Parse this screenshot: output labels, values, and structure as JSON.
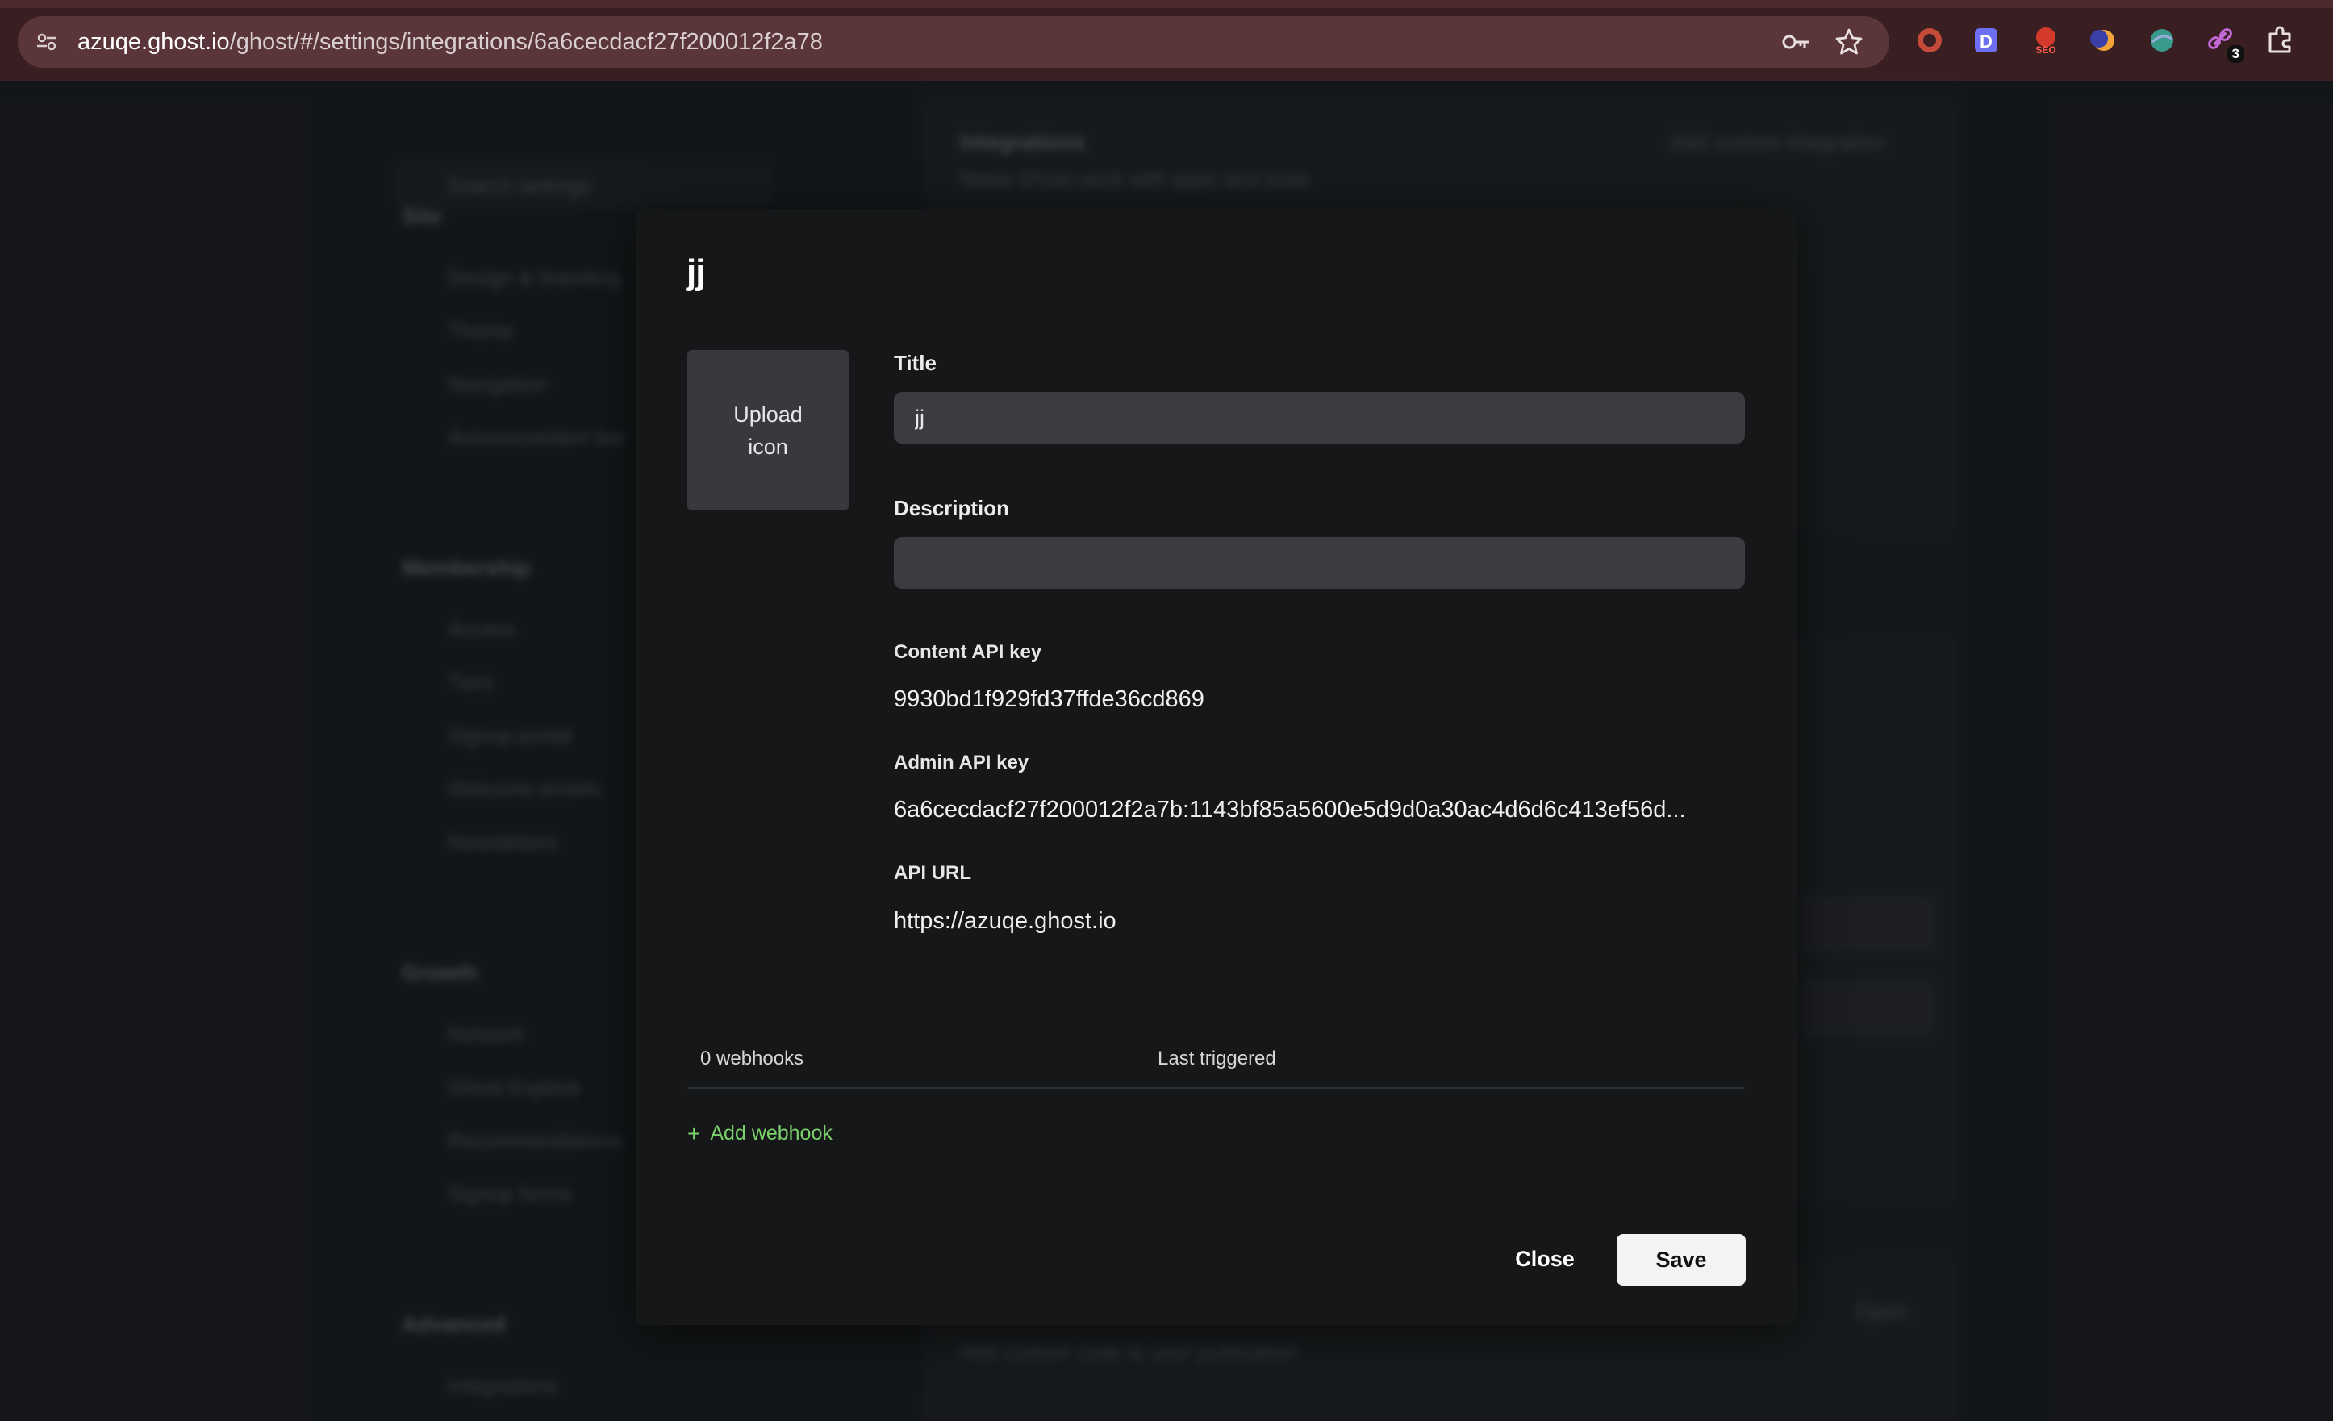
{
  "browser": {
    "url_host": "azuqe.ghost.io",
    "url_path": "/ghost/#/settings/integrations/6a6cecdacf27f200012f2a78",
    "extension_badge": "3"
  },
  "background": {
    "sidebar": {
      "search_placeholder": "Search settings",
      "site_heading": "Site",
      "site_items": [
        "Design & branding",
        "Theme",
        "Navigation",
        "Announcement bar"
      ],
      "membership_heading": "Membership",
      "membership_items": [
        "Access",
        "Tiers",
        "Signup portal",
        "Welcome emails",
        "Newsletters"
      ],
      "growth_heading": "Growth",
      "growth_items": [
        "Network",
        "Ghost Explore",
        "Recommendations",
        "Signup forms"
      ],
      "advanced_heading": "Advanced",
      "advanced_items": [
        "Integrations"
      ]
    },
    "main": {
      "integrations_title": "Integrations",
      "integrations_subtitle": "Make Ghost work with apps and tools.",
      "add_custom_integration": "Add custom integration",
      "code_injection_subtitle": "Add custom code to your publication",
      "open_label": "Open"
    }
  },
  "modal": {
    "title": "jj",
    "upload_icon_label": "Upload icon",
    "title_label": "Title",
    "title_value": "jj",
    "description_label": "Description",
    "description_value": "",
    "content_api_key_label": "Content API key",
    "content_api_key": "9930bd1f929fd37ffde36cd869",
    "admin_api_key_label": "Admin API key",
    "admin_api_key": "6a6cecdacf27f200012f2a7b:1143bf85a5600e5d9d0a30ac4d6d6c413ef56d...",
    "api_url_label": "API URL",
    "api_url": "https://azuqe.ghost.io",
    "webhooks_count": "0 webhooks",
    "last_triggered_label": "Last triggered",
    "add_webhook_label": "Add webhook",
    "close_label": "Close",
    "save_label": "Save"
  },
  "colors": {
    "modal_bg": "#151718",
    "accent_green": "#7ad06b",
    "browser_frame": "#3a1f22"
  }
}
